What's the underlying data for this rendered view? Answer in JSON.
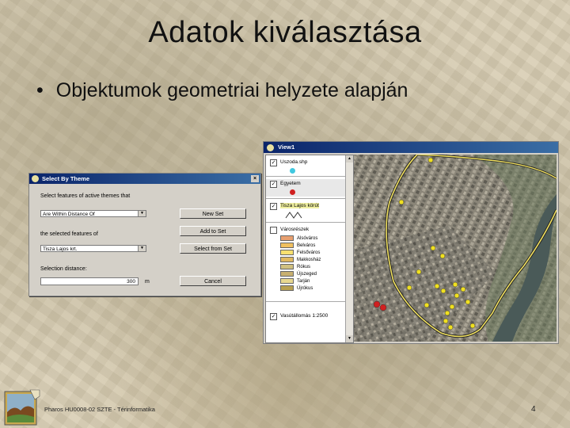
{
  "slide": {
    "title": "Adatok kiválasztása",
    "bullet": "Objektumok geometriai helyzete alapján",
    "bullet_symbol": "•"
  },
  "dialog": {
    "title": "Select By Theme",
    "close": "×",
    "label_select": "Select features of active themes that",
    "relation_value": "Are Within Distance Of",
    "label_selected": "the selected features of",
    "theme_value": "Tisza Lajos krt.",
    "label_distance": "Selection distance:",
    "distance_value": "300",
    "unit": "m",
    "buttons": [
      "New Set",
      "Add to Set",
      "Select from Set",
      "Cancel"
    ]
  },
  "view": {
    "title": "View1",
    "themes": [
      {
        "name": "Uszoda.shp",
        "checked": true,
        "color": "#40c8e0"
      },
      {
        "name": "Egyetem",
        "checked": true,
        "color": "#d02020"
      },
      {
        "name": "Tisza Lajos körút",
        "checked": true,
        "color": "#c8b040"
      },
      {
        "name": "Városrészek",
        "checked": false,
        "color": ""
      },
      {
        "name": "Vasútállomás 1:2500",
        "checked": true,
        "color": ""
      }
    ],
    "legend": [
      {
        "label": "Alsóváros",
        "color": "#e8a070"
      },
      {
        "label": "Belváros",
        "color": "#f0c060"
      },
      {
        "label": "Felsőváros",
        "color": "#f8e070"
      },
      {
        "label": "Makkosház",
        "color": "#e0b860"
      },
      {
        "label": "Rókus",
        "color": "#d0c080"
      },
      {
        "label": "Újszeged",
        "color": "#c8b070"
      },
      {
        "label": "Tarján",
        "color": "#e8d890"
      },
      {
        "label": "Újrókus",
        "color": "#b8a050"
      }
    ]
  },
  "footer": {
    "text": "Pharos HU0008-02 SZTE - Térinformatika",
    "page": "4"
  },
  "colors": {
    "title_bar": "#0a246a",
    "selection_point": "#f0e020",
    "road": "#f0e060"
  }
}
